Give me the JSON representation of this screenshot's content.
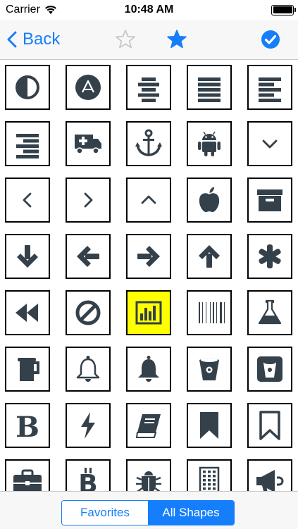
{
  "status_bar": {
    "carrier": "Carrier",
    "time": "10:48 AM"
  },
  "nav": {
    "back_label": "Back"
  },
  "segments": [
    {
      "label": "Favorites"
    },
    {
      "label": "All Shapes"
    }
  ],
  "colors": {
    "accent": "#157efb",
    "icon": "#34404a",
    "selected_bg": "#ffff00"
  },
  "icons": [
    "adjust",
    "adn",
    "align-center",
    "align-justify",
    "align-left",
    "align-right",
    "ambulance",
    "anchor",
    "android",
    "angle-down",
    "angle-left",
    "angle-right",
    "angle-up",
    "apple",
    "archive",
    "arrow-down",
    "arrow-left",
    "arrow-right",
    "arrow-up",
    "asterisk",
    "backward",
    "ban",
    "bar-chart",
    "barcode",
    "beaker",
    "beer",
    "bell",
    "bell-alt",
    "bitbucket",
    "bitbucket-sign",
    "bold",
    "bolt",
    "book",
    "bookmark",
    "bookmark-empty",
    "briefcase",
    "btc",
    "bug",
    "building",
    "bullhorn"
  ],
  "selected_icon": "bar-chart"
}
